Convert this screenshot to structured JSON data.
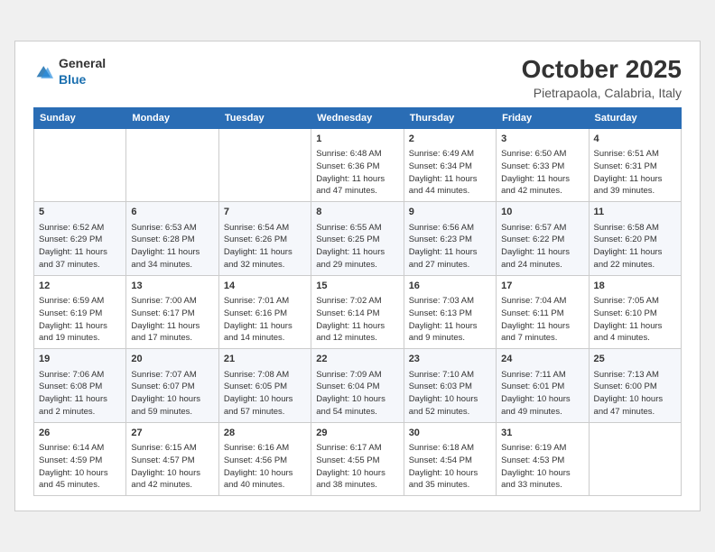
{
  "header": {
    "logo_general": "General",
    "logo_blue": "Blue",
    "month": "October 2025",
    "location": "Pietrapaola, Calabria, Italy"
  },
  "weekdays": [
    "Sunday",
    "Monday",
    "Tuesday",
    "Wednesday",
    "Thursday",
    "Friday",
    "Saturday"
  ],
  "weeks": [
    [
      {
        "day": "",
        "info": ""
      },
      {
        "day": "",
        "info": ""
      },
      {
        "day": "",
        "info": ""
      },
      {
        "day": "1",
        "info": "Sunrise: 6:48 AM\nSunset: 6:36 PM\nDaylight: 11 hours\nand 47 minutes."
      },
      {
        "day": "2",
        "info": "Sunrise: 6:49 AM\nSunset: 6:34 PM\nDaylight: 11 hours\nand 44 minutes."
      },
      {
        "day": "3",
        "info": "Sunrise: 6:50 AM\nSunset: 6:33 PM\nDaylight: 11 hours\nand 42 minutes."
      },
      {
        "day": "4",
        "info": "Sunrise: 6:51 AM\nSunset: 6:31 PM\nDaylight: 11 hours\nand 39 minutes."
      }
    ],
    [
      {
        "day": "5",
        "info": "Sunrise: 6:52 AM\nSunset: 6:29 PM\nDaylight: 11 hours\nand 37 minutes."
      },
      {
        "day": "6",
        "info": "Sunrise: 6:53 AM\nSunset: 6:28 PM\nDaylight: 11 hours\nand 34 minutes."
      },
      {
        "day": "7",
        "info": "Sunrise: 6:54 AM\nSunset: 6:26 PM\nDaylight: 11 hours\nand 32 minutes."
      },
      {
        "day": "8",
        "info": "Sunrise: 6:55 AM\nSunset: 6:25 PM\nDaylight: 11 hours\nand 29 minutes."
      },
      {
        "day": "9",
        "info": "Sunrise: 6:56 AM\nSunset: 6:23 PM\nDaylight: 11 hours\nand 27 minutes."
      },
      {
        "day": "10",
        "info": "Sunrise: 6:57 AM\nSunset: 6:22 PM\nDaylight: 11 hours\nand 24 minutes."
      },
      {
        "day": "11",
        "info": "Sunrise: 6:58 AM\nSunset: 6:20 PM\nDaylight: 11 hours\nand 22 minutes."
      }
    ],
    [
      {
        "day": "12",
        "info": "Sunrise: 6:59 AM\nSunset: 6:19 PM\nDaylight: 11 hours\nand 19 minutes."
      },
      {
        "day": "13",
        "info": "Sunrise: 7:00 AM\nSunset: 6:17 PM\nDaylight: 11 hours\nand 17 minutes."
      },
      {
        "day": "14",
        "info": "Sunrise: 7:01 AM\nSunset: 6:16 PM\nDaylight: 11 hours\nand 14 minutes."
      },
      {
        "day": "15",
        "info": "Sunrise: 7:02 AM\nSunset: 6:14 PM\nDaylight: 11 hours\nand 12 minutes."
      },
      {
        "day": "16",
        "info": "Sunrise: 7:03 AM\nSunset: 6:13 PM\nDaylight: 11 hours\nand 9 minutes."
      },
      {
        "day": "17",
        "info": "Sunrise: 7:04 AM\nSunset: 6:11 PM\nDaylight: 11 hours\nand 7 minutes."
      },
      {
        "day": "18",
        "info": "Sunrise: 7:05 AM\nSunset: 6:10 PM\nDaylight: 11 hours\nand 4 minutes."
      }
    ],
    [
      {
        "day": "19",
        "info": "Sunrise: 7:06 AM\nSunset: 6:08 PM\nDaylight: 11 hours\nand 2 minutes."
      },
      {
        "day": "20",
        "info": "Sunrise: 7:07 AM\nSunset: 6:07 PM\nDaylight: 10 hours\nand 59 minutes."
      },
      {
        "day": "21",
        "info": "Sunrise: 7:08 AM\nSunset: 6:05 PM\nDaylight: 10 hours\nand 57 minutes."
      },
      {
        "day": "22",
        "info": "Sunrise: 7:09 AM\nSunset: 6:04 PM\nDaylight: 10 hours\nand 54 minutes."
      },
      {
        "day": "23",
        "info": "Sunrise: 7:10 AM\nSunset: 6:03 PM\nDaylight: 10 hours\nand 52 minutes."
      },
      {
        "day": "24",
        "info": "Sunrise: 7:11 AM\nSunset: 6:01 PM\nDaylight: 10 hours\nand 49 minutes."
      },
      {
        "day": "25",
        "info": "Sunrise: 7:13 AM\nSunset: 6:00 PM\nDaylight: 10 hours\nand 47 minutes."
      }
    ],
    [
      {
        "day": "26",
        "info": "Sunrise: 6:14 AM\nSunset: 4:59 PM\nDaylight: 10 hours\nand 45 minutes."
      },
      {
        "day": "27",
        "info": "Sunrise: 6:15 AM\nSunset: 4:57 PM\nDaylight: 10 hours\nand 42 minutes."
      },
      {
        "day": "28",
        "info": "Sunrise: 6:16 AM\nSunset: 4:56 PM\nDaylight: 10 hours\nand 40 minutes."
      },
      {
        "day": "29",
        "info": "Sunrise: 6:17 AM\nSunset: 4:55 PM\nDaylight: 10 hours\nand 38 minutes."
      },
      {
        "day": "30",
        "info": "Sunrise: 6:18 AM\nSunset: 4:54 PM\nDaylight: 10 hours\nand 35 minutes."
      },
      {
        "day": "31",
        "info": "Sunrise: 6:19 AM\nSunset: 4:53 PM\nDaylight: 10 hours\nand 33 minutes."
      },
      {
        "day": "",
        "info": ""
      }
    ]
  ]
}
